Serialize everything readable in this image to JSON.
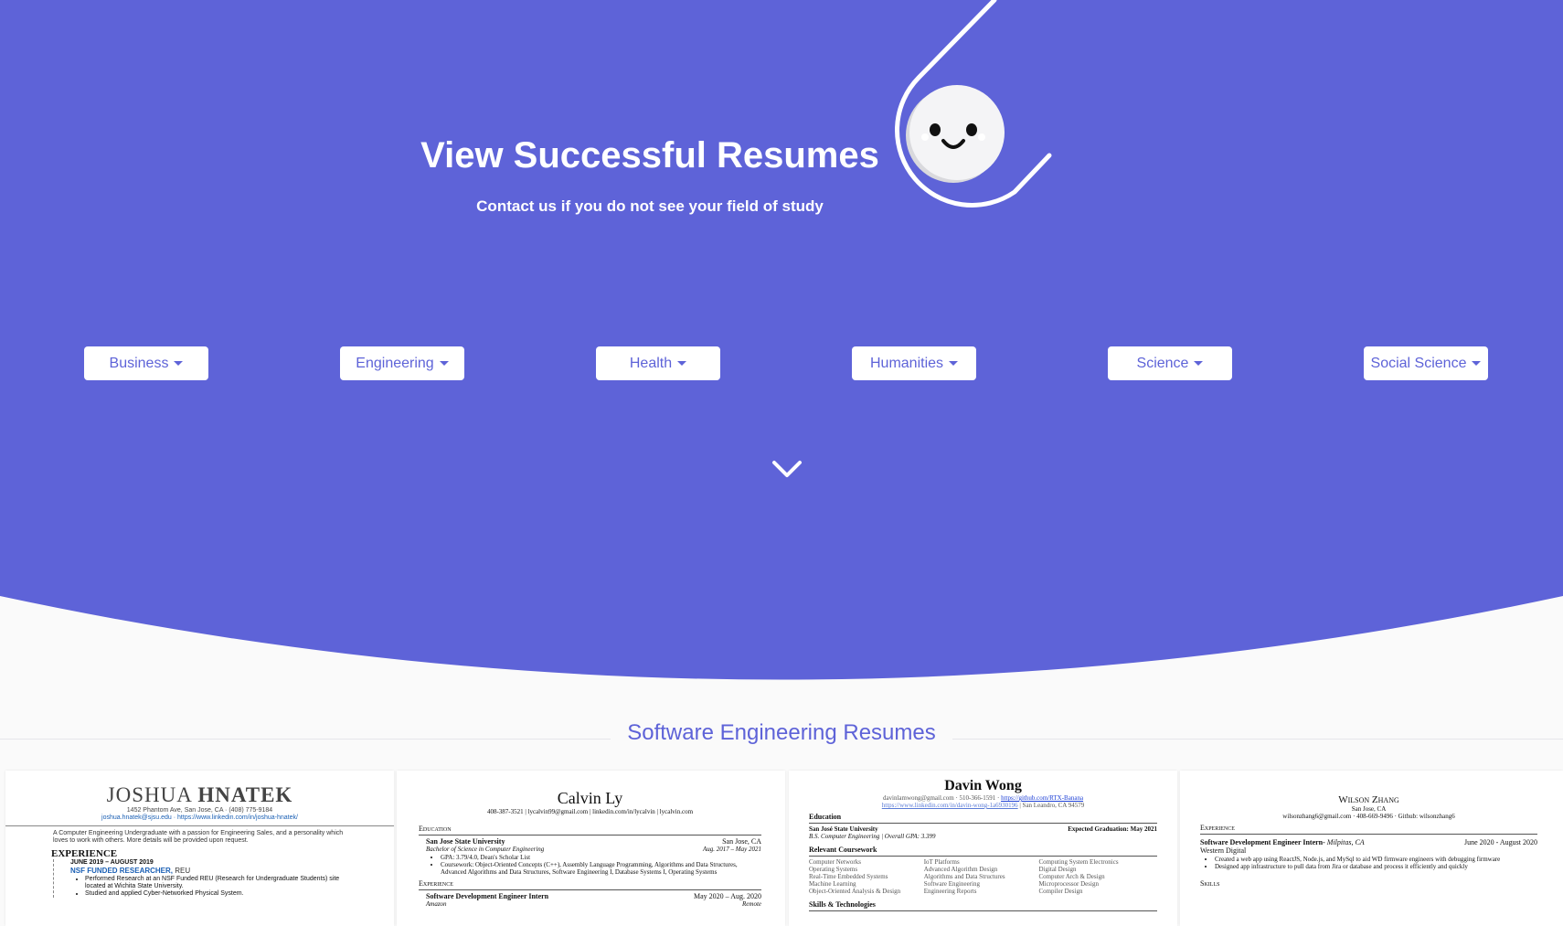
{
  "hero": {
    "title": "View Successful Resumes",
    "subtitle": "Contact us if you do not see your field of study",
    "background_color": "#5e63d8",
    "mascot_icon": "smiley-face-icon"
  },
  "categories": [
    {
      "label": "Business"
    },
    {
      "label": "Engineering"
    },
    {
      "label": "Health"
    },
    {
      "label": "Humanities"
    },
    {
      "label": "Science"
    },
    {
      "label": "Social Science"
    }
  ],
  "scroll_icon": "chevron-down-icon",
  "section": {
    "title": "Software Engineering Resumes"
  },
  "resumes": [
    {
      "name_first": "JOSHUA",
      "name_last": "HNATEK",
      "address": "1452 Phantom Ave, San Jose, CA · (408) 775-9184",
      "links": "joshua.hnatek@sjsu.edu · https://www.linkedin.com/in/joshua-hnatek/",
      "summary": "A Computer Engineering Undergraduate with a passion for Engineering Sales, and a personality which loves to work with others. More details will be provided upon request.",
      "section": "EXPERIENCE",
      "dates": "JUNE 2019 – AUGUST 2019",
      "role": "NSF FUNDED RESEARCHER,",
      "org": "REU",
      "bullets": [
        "Performed Research at an NSF Funded REU (Research for Undergraduate Students) site located at Wichita State University.",
        "Studied and applied Cyber-Networked Physical System."
      ]
    },
    {
      "name": "Calvin Ly",
      "contact": "408-387-3521 | lycalvin99@gmail.com | linkedin.com/in/lycalvin | lycalvin.com",
      "education_header": "Education",
      "school": "San Jose State University",
      "location": "San Jose, CA",
      "degree": "Bachelor of Science in Computer Engineering",
      "degree_dates": "Aug. 2017 – May 2021",
      "bullets": [
        "GPA: 3.79/4.0, Dean's Scholar List",
        "Coursework: Object-Oriented Concepts (C++), Assembly Language Programming, Algorithms and Data Structures, Advanced Algorithms and Data Structures, Software Engineering I, Database Systems I, Operating Systems"
      ],
      "experience_header": "Experience",
      "job_title": "Software Development Engineer Intern",
      "job_dates": "May 2020 – Aug. 2020",
      "company": "Amazon",
      "job_location": "Remote"
    },
    {
      "name": "Davin Wong",
      "email": "davinlamwong@gmail.com · 510-366-1591 ·",
      "github": "https://github.com/RTX-Banana",
      "linkedin": "https://www.linkedin.com/in/davin-wong-1a6930196",
      "city": "| San Leandro, CA 94579",
      "education_header": "Education",
      "school": "San José State University",
      "grad": "Expected Graduation: May 2021",
      "degree": "B.S. Computer Engineering | Overall GPA: 3.399",
      "coursework_header": "Relevant Coursework",
      "courses": [
        [
          "Computer Networks",
          "Operating Systems",
          "Real-Time Embedded Systems",
          "Machine Learning",
          "Object-Oriented Analysis & Design"
        ],
        [
          "IoT Platforms",
          "Advanced Algorithm Design",
          "Algorithms and Data Structures",
          "Software Engineering",
          "Engineering Reports"
        ],
        [
          "Computing System Electronics",
          "Digital Design",
          "Computer Arch & Design",
          "Microprocessor Design",
          "Compiler Design"
        ]
      ],
      "skills_header": "Skills & Technologies"
    },
    {
      "name": "Wilson Zhang",
      "location": "San Jose, CA",
      "contact": "wilsonzhang6@gmail.com · 408-669-9496 · Github: wilsonzhang6",
      "experience_header": "Experience",
      "job_title": "Software Development Engineer Intern-",
      "job_location": "Milpitas, CA",
      "job_dates": "June 2020 - August 2020",
      "company": "Western Digital",
      "bullets": [
        "Created a web app using ReactJS, Node.js, and MySql to aid WD firmware engineers with debugging firmware",
        "Designed app infrastructure to pull data from Jira or database and process it efficiently and quickly"
      ],
      "skills_header": "Skills"
    }
  ]
}
